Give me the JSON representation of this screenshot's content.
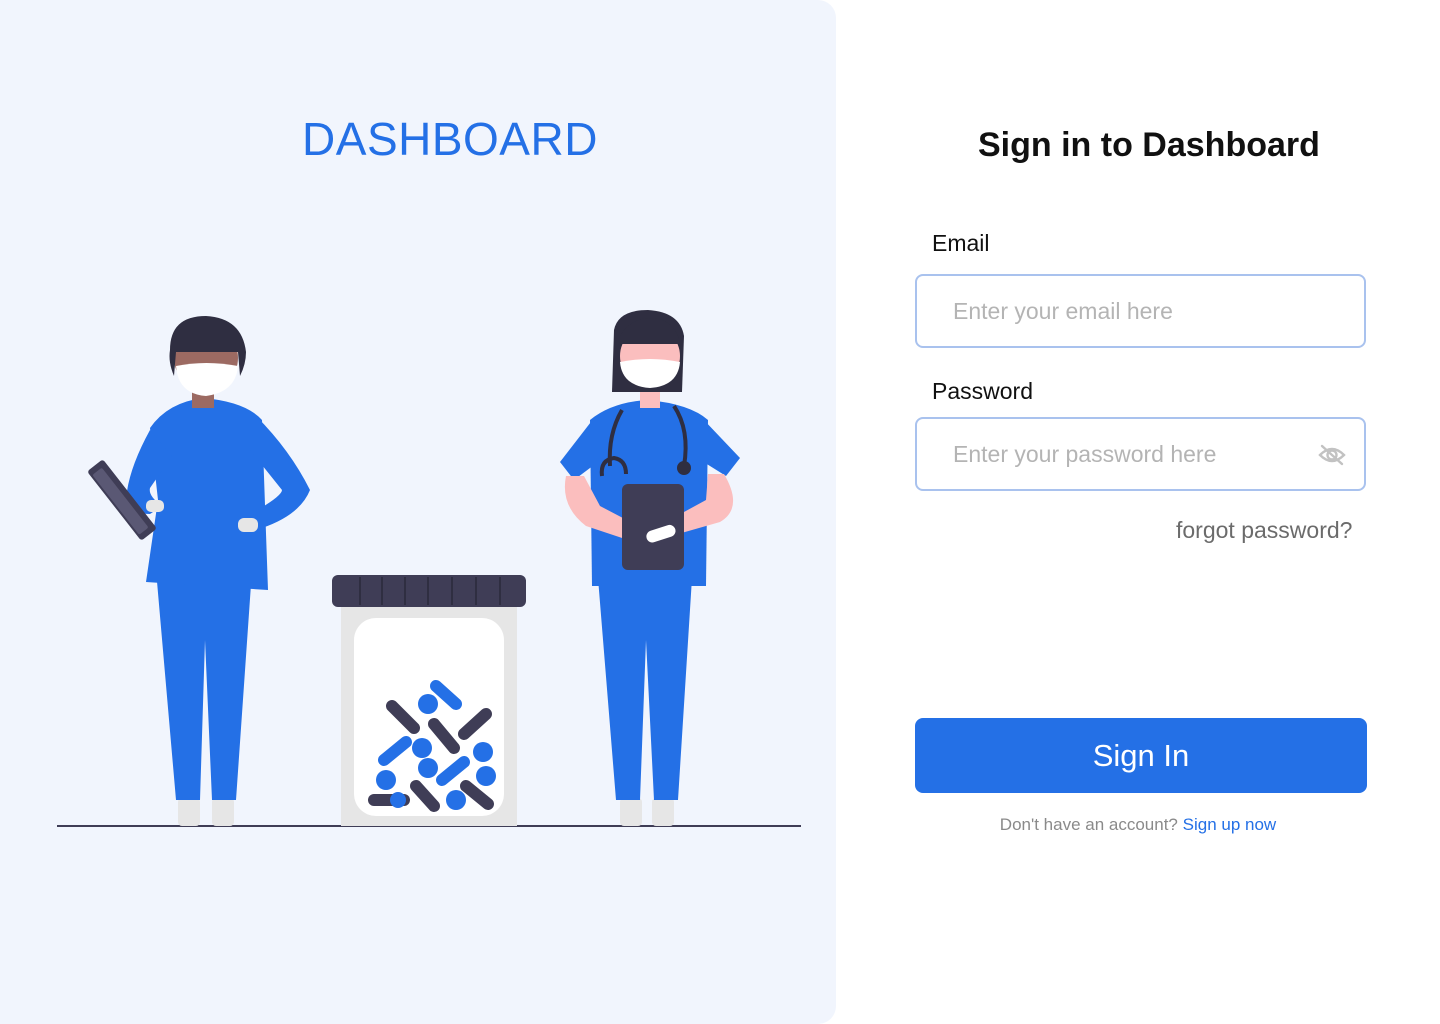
{
  "brand": {
    "title": "DASHBOARD"
  },
  "form": {
    "title": "Sign in to Dashboard",
    "email_label": "Email",
    "email_placeholder": "Enter your email here",
    "password_label": "Password",
    "password_placeholder": "Enter your password here",
    "forgot_link": "forgot password?",
    "signin_button": "Sign In",
    "signup_prompt": "Don't have an account?",
    "signup_link": "Sign up now"
  },
  "icons": {
    "password_visibility": "eye-off-icon"
  },
  "colors": {
    "accent": "#2470e6",
    "panel_background": "#f1f5fd",
    "input_border": "#a9c2ee",
    "dark": "#3f3d56"
  }
}
